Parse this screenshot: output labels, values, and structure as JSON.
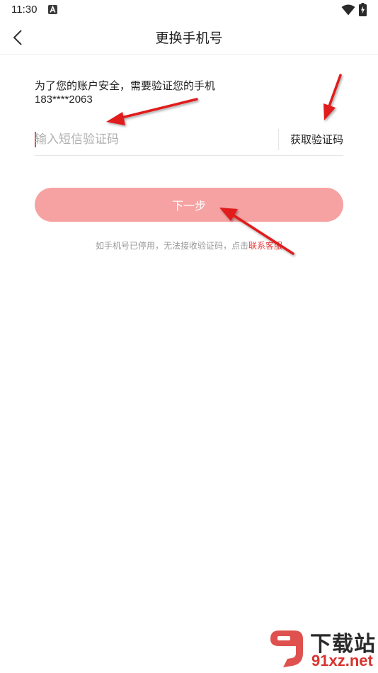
{
  "status_bar": {
    "time": "11:30",
    "notification_icon": "a-letter-icon",
    "wifi_icon": "wifi-icon",
    "battery_icon": "battery-charging-icon"
  },
  "header": {
    "title": "更换手机号",
    "back_icon": "chevron-left-icon"
  },
  "form": {
    "prompt": "为了您的账户安全，需要验证您的手机",
    "phone": "183****2063",
    "code_placeholder": "输入短信验证码",
    "code_value": "",
    "get_code_label": "获取验证码",
    "next_label": "下一步"
  },
  "help": {
    "text": "如手机号已停用，无法接收验证码，点击",
    "link": "联系客服"
  },
  "watermark": {
    "name": "下载站",
    "domain": "91xz.net"
  },
  "colors": {
    "accent": "#e83b3b",
    "button_bg": "#f7a2a2",
    "placeholder": "#b0b0b0",
    "arrow": "#e01b1b"
  }
}
